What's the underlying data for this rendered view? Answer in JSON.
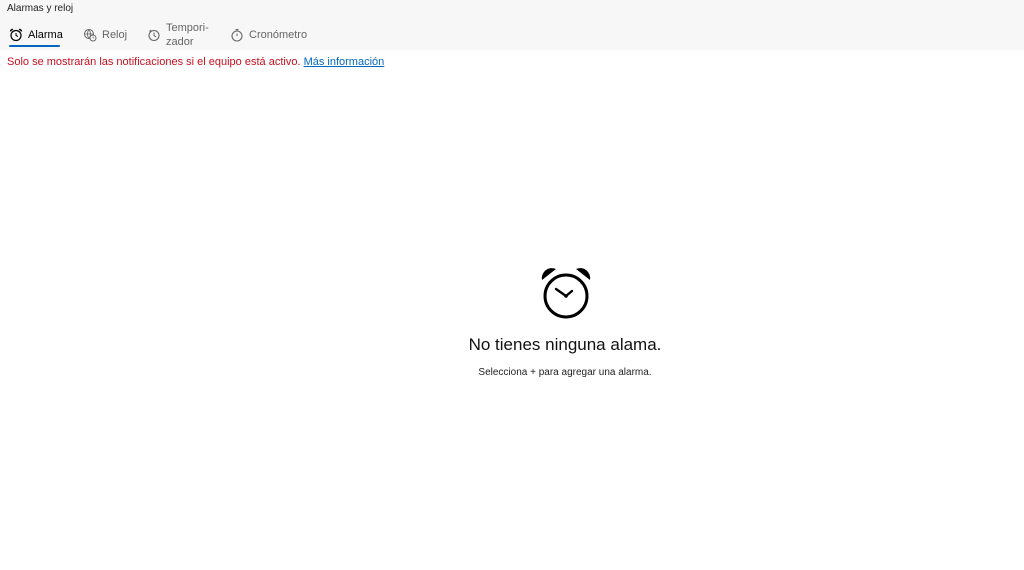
{
  "window": {
    "title": "Alarmas y reloj"
  },
  "tabs": [
    {
      "label": "Alarma",
      "icon": "alarm-clock-icon",
      "active": true
    },
    {
      "label": "Reloj",
      "icon": "world-clock-icon",
      "active": false
    },
    {
      "label": "Tempori-\nzador",
      "icon": "timer-icon",
      "active": false
    },
    {
      "label": "Cronómetro",
      "icon": "stopwatch-icon",
      "active": false
    }
  ],
  "notice": {
    "text": "Solo se mostrarán las notificaciones si el equipo está activo.",
    "link": "Más información"
  },
  "empty_state": {
    "icon": "alarm-clock-icon",
    "title": "No tienes ninguna alama.",
    "hint": "Selecciona + para agregar una alarma."
  },
  "colors": {
    "accent": "#0067c0",
    "warning": "#c50f1f",
    "chrome": "#f7f7f7"
  }
}
